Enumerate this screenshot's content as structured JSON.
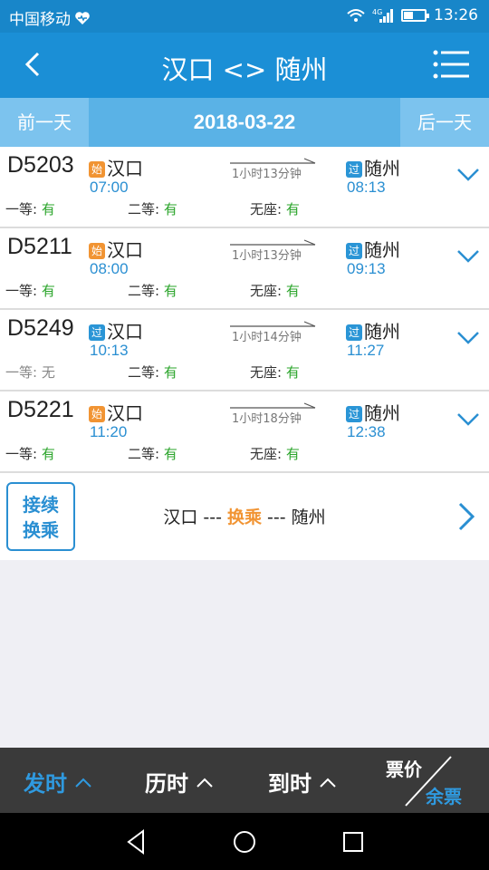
{
  "status_bar": {
    "carrier": "中国移动",
    "time": "13:26",
    "network": "4G"
  },
  "header": {
    "title": "汉口 <> 随州"
  },
  "date_bar": {
    "prev_label": "前一天",
    "date": "2018-03-22",
    "next_label": "后一天"
  },
  "trains": [
    {
      "number": "D5203",
      "from_badge": "始",
      "from_badge_type": "start",
      "from": "汉口",
      "depart": "07:00",
      "duration": "1小时13分钟",
      "to_badge": "过",
      "to": "随州",
      "arrive": "08:13",
      "seats": [
        {
          "label": "一等:",
          "value": "有",
          "available": true
        },
        {
          "label": "二等:",
          "value": "有",
          "available": true
        },
        {
          "label": "无座:",
          "value": "有",
          "available": true
        }
      ]
    },
    {
      "number": "D5211",
      "from_badge": "始",
      "from_badge_type": "start",
      "from": "汉口",
      "depart": "08:00",
      "duration": "1小时13分钟",
      "to_badge": "过",
      "to": "随州",
      "arrive": "09:13",
      "seats": [
        {
          "label": "一等:",
          "value": "有",
          "available": true
        },
        {
          "label": "二等:",
          "value": "有",
          "available": true
        },
        {
          "label": "无座:",
          "value": "有",
          "available": true
        }
      ]
    },
    {
      "number": "D5249",
      "from_badge": "过",
      "from_badge_type": "pass",
      "from": "汉口",
      "depart": "10:13",
      "duration": "1小时14分钟",
      "to_badge": "过",
      "to": "随州",
      "arrive": "11:27",
      "seats": [
        {
          "label": "一等:",
          "value": "无",
          "available": false
        },
        {
          "label": "二等:",
          "value": "有",
          "available": true
        },
        {
          "label": "无座:",
          "value": "有",
          "available": true
        }
      ]
    },
    {
      "number": "D5221",
      "from_badge": "始",
      "from_badge_type": "start",
      "from": "汉口",
      "depart": "11:20",
      "duration": "1小时18分钟",
      "to_badge": "过",
      "to": "随州",
      "arrive": "12:38",
      "seats": [
        {
          "label": "一等:",
          "value": "有",
          "available": true
        },
        {
          "label": "二等:",
          "value": "有",
          "available": true
        },
        {
          "label": "无座:",
          "value": "有",
          "available": true
        }
      ]
    }
  ],
  "transfer": {
    "badge_line1": "接续",
    "badge_line2": "换乘",
    "from": "汉口",
    "sep1": " --- ",
    "middle": "换乘",
    "sep2": " --- ",
    "to": "随州"
  },
  "sort_bar": {
    "depart_label": "发时",
    "duration_label": "历时",
    "arrive_label": "到时",
    "price_label": "票价",
    "remaining_label": "余票",
    "active": "depart"
  },
  "colors": {
    "primary": "#1b8fd6",
    "accent_orange": "#f19433",
    "available_green": "#2aa42a",
    "sort_active": "#2f9ae0"
  }
}
